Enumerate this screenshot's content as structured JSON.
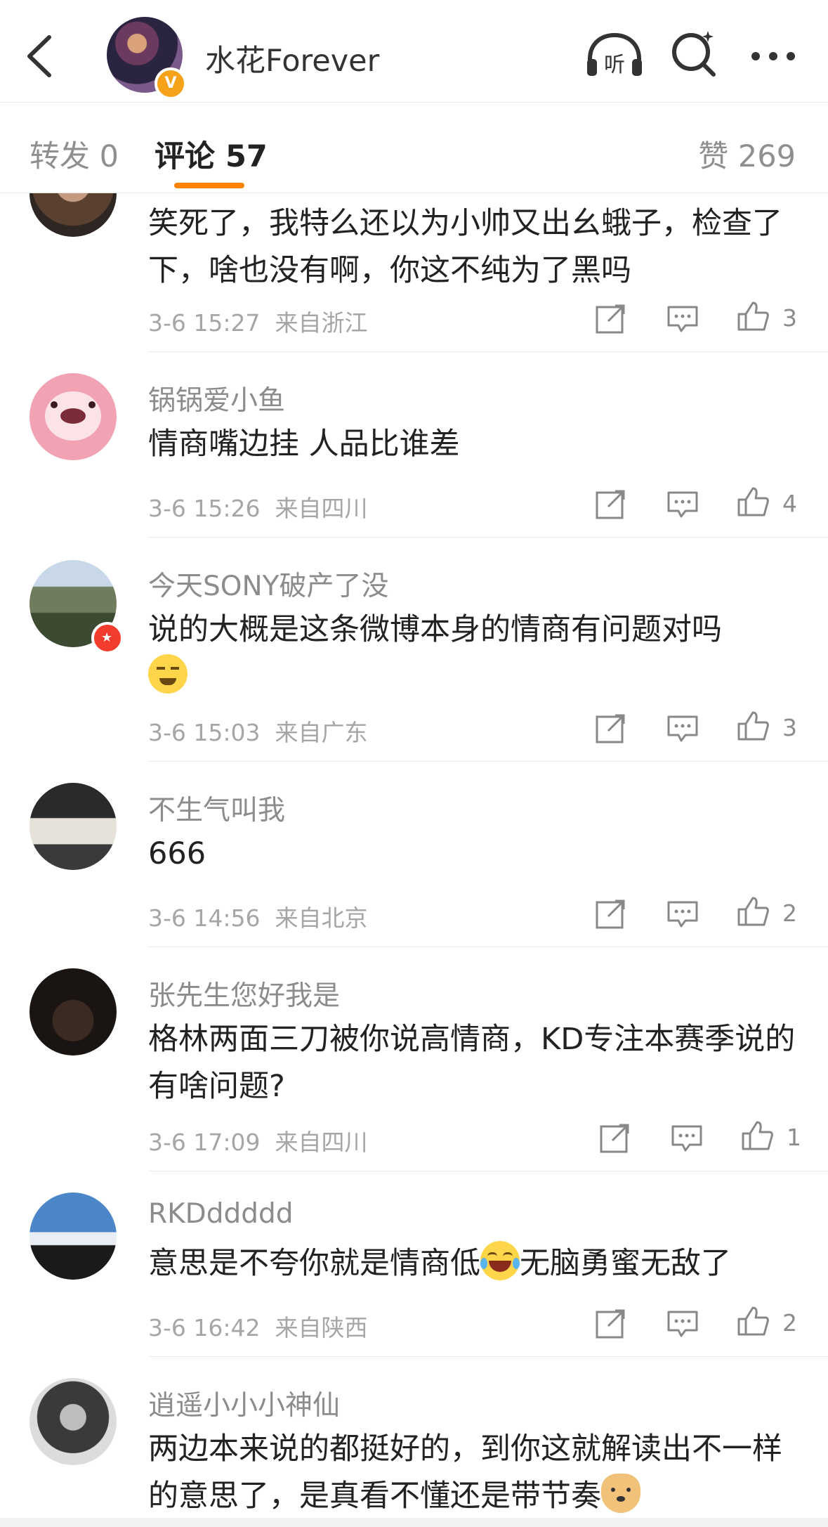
{
  "header": {
    "title": "水花Forever",
    "verified_badge": "V",
    "listen_label": "听"
  },
  "tabs": {
    "repost": "转发 0",
    "comments": "评论 57",
    "likes": "赞 269"
  },
  "comments": [
    {
      "name": "",
      "text": "笑死了，我特么还以为小帅又出幺蛾子，检查了下，啥也没有啊，你这不纯为了黑吗",
      "time": "3-6 15:27",
      "location": "来自浙江",
      "likes": "3"
    },
    {
      "name": "锅锅爱小鱼",
      "text": "情商嘴边挂 人品比谁差",
      "time": "3-6 15:26",
      "location": "来自四川",
      "likes": "4"
    },
    {
      "name": "今天SONY破产了没",
      "text": "说的大概是这条微博本身的情商有问题对吗",
      "time": "3-6 15:03",
      "location": "来自广东",
      "likes": "3"
    },
    {
      "name": "不生气叫我",
      "text": "666",
      "time": "3-6 14:56",
      "location": "来自北京",
      "likes": "2"
    },
    {
      "name": "张先生您好我是",
      "text": "格林两面三刀被你说高情商，KD专注本赛季说的有啥问题?",
      "time": "3-6 17:09",
      "location": "来自四川",
      "likes": "1"
    },
    {
      "name": "RKDddddd",
      "text_before": "意思是不夸你就是情商低",
      "text_after": "无脑勇蜜无敌了",
      "time": "3-6 16:42",
      "location": "来自陕西",
      "likes": "2"
    },
    {
      "name": "逍遥小小小神仙",
      "text": "两边本来说的都挺好的，到你这就解读出不一样的意思了，是真看不懂还是带节奏"
    }
  ],
  "colors": {
    "accent": "#ff8200",
    "verified": "#f7a21b"
  },
  "icons": [
    "back-icon",
    "listen-icon",
    "search-icon",
    "more-icon",
    "share-icon",
    "comment-icon",
    "like-icon"
  ]
}
